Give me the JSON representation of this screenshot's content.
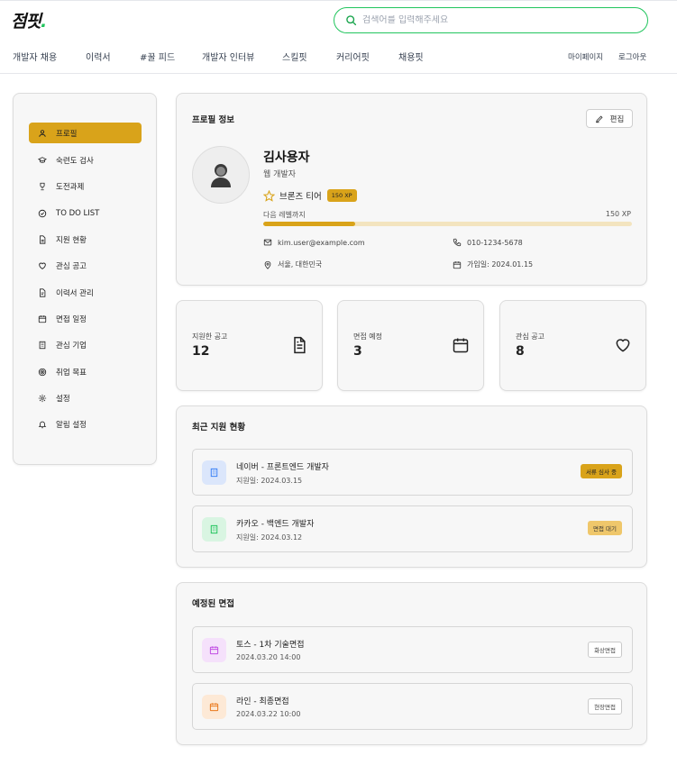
{
  "app": {
    "logo_text": "점핏",
    "logo_dot": "."
  },
  "search": {
    "placeholder": "검색어를 입력해주세요",
    "value": ""
  },
  "nav": {
    "items": [
      "개발자 채용",
      "이력서",
      "#꿀 피드",
      "개발자 인터뷰",
      "스킬핏",
      "커리어핏",
      "채용핏"
    ],
    "my_page": "마이페이지",
    "logout": "로그아웃"
  },
  "sidebar": {
    "items": [
      {
        "label": "프로필",
        "icon": "user-icon",
        "active": true
      },
      {
        "label": "숙련도 검사",
        "icon": "graduation-cap-icon"
      },
      {
        "label": "도전과제",
        "icon": "trophy-icon"
      },
      {
        "label": "TO DO LIST",
        "icon": "check-circle-icon"
      },
      {
        "label": "지원 현황",
        "icon": "document-icon"
      },
      {
        "label": "관심 공고",
        "icon": "heart-icon"
      },
      {
        "label": "이력서 관리",
        "icon": "file-icon"
      },
      {
        "label": "면접 일정",
        "icon": "calendar-icon"
      },
      {
        "label": "관심 기업",
        "icon": "building-icon"
      },
      {
        "label": "취업 목표",
        "icon": "target-icon"
      },
      {
        "label": "설정",
        "icon": "gear-icon"
      },
      {
        "label": "알림 설정",
        "icon": "bell-icon"
      }
    ]
  },
  "profile": {
    "title": "프로필 정보",
    "edit_label": "편집",
    "name": "김사용자",
    "role": "웹 개발자",
    "tier": "브론즈 티어",
    "xp_badge": "150 XP",
    "next_level_label": "다음 레벨까지",
    "next_level_value": "150 XP",
    "progress_fraction": 0.25,
    "email": "kim.user@example.com",
    "phone": "010-1234-5678",
    "location": "서울, 대한민국",
    "joined": "가입일: 2024.01.15"
  },
  "stats": [
    {
      "label": "지원한 공고",
      "value": "12",
      "icon": "document-icon"
    },
    {
      "label": "면접 예정",
      "value": "3",
      "icon": "calendar-icon"
    },
    {
      "label": "관심 공고",
      "value": "8",
      "icon": "heart-icon"
    }
  ],
  "recent_applications": {
    "title": "최근 지원 현황",
    "items": [
      {
        "title": "네이버 - 프론트엔드 개발자",
        "date": "지원일: 2024.03.15",
        "status": "서류 심사 중",
        "icon_color": "#3b82f6",
        "icon_bg": "#dbe6fb"
      },
      {
        "title": "카카오 - 백엔드 개발자",
        "date": "지원일: 2024.03.12",
        "status": "면접 대기",
        "icon_color": "#22c55e",
        "icon_bg": "#d9f5e2"
      }
    ]
  },
  "interviews": {
    "title": "예정된 면접",
    "items": [
      {
        "title": "토스 - 1차 기술면접",
        "datetime": "2024.03.20 14:00",
        "type": "화상면접",
        "icon_color": "#c14de3",
        "icon_bg": "#f5e1fb"
      },
      {
        "title": "라인 - 최종면접",
        "datetime": "2024.03.22 10:00",
        "type": "현장면접",
        "icon_color": "#ea7a1e",
        "icon_bg": "#fde9d6"
      }
    ]
  },
  "colors": {
    "accent": "#d9a31a",
    "search_border": "#22c55e"
  }
}
